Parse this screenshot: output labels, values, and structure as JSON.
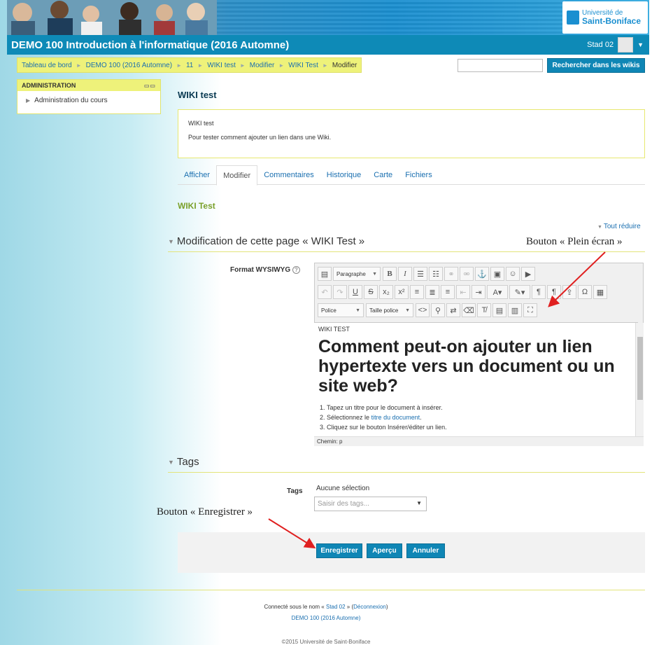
{
  "header": {
    "logo_line1": "Université de",
    "logo_line2": "Saint-Boniface",
    "course_title": "DEMO 100 Introduction à l'informatique (2016 Automne)",
    "user_name": "Stad 02"
  },
  "breadcrumb": [
    "Tableau de bord",
    "DEMO 100 (2016 Automne)",
    "11",
    "WIKI test",
    "Modifier",
    "WIKI Test",
    "Modifier"
  ],
  "search": {
    "placeholder": "",
    "button": "Rechercher dans les wikis"
  },
  "admin_block": {
    "title": "ADMINISTRATION",
    "item": "Administration du cours"
  },
  "wiki": {
    "title": "WIKI test",
    "intro_title": "WIKI test",
    "intro_text": "Pour tester comment ajouter un lien dans une Wiki.",
    "tabs": [
      "Afficher",
      "Modifier",
      "Commentaires",
      "Historique",
      "Carte",
      "Fichiers"
    ],
    "active_tab": "Modifier",
    "page_name": "WIKI Test",
    "collapse_all": "Tout réduire",
    "edit_section": "Modification de cette page « WIKI Test »",
    "format_label": "Format WYSIWYG"
  },
  "editor": {
    "paragraph_dd": "Paragraphe",
    "font_dd": "Police",
    "size_dd": "Taille police",
    "content_label": "WIKI TEST",
    "heading": "Comment peut-on ajouter un lien hypertexte vers un document ou un site web?",
    "list": [
      "Tapez un titre pour le document à insérer.",
      "Sélectionnez le",
      "titre du document",
      "Cliquez sur le bouton Insérer/éditer un lien."
    ],
    "status": "Chemin: p"
  },
  "tags": {
    "section": "Tags",
    "label": "Tags",
    "selection": "Aucune sélection",
    "input_placeholder": "Saisir des tags..."
  },
  "buttons": {
    "save": "Enregistrer",
    "preview": "Aperçu",
    "cancel": "Annuler"
  },
  "annotations": {
    "fullscreen": "Bouton « Plein écran »",
    "save": "Bouton « Enregistrer »"
  },
  "footer": {
    "logged_prefix": "Connecté sous le nom «",
    "user": "Stad 02",
    "logged_mid": "» (",
    "logout": "Déconnexion",
    "logged_suffix": ")",
    "course_link": "DEMO 100 (2016 Automne)",
    "copyright": "©2015 Université de Saint-Boniface"
  },
  "colors": {
    "brand_blue": "#0e8ab7",
    "accent_yellow": "#eef27a",
    "button_blue": "#0f86b5",
    "arrow_red": "#e02020"
  }
}
